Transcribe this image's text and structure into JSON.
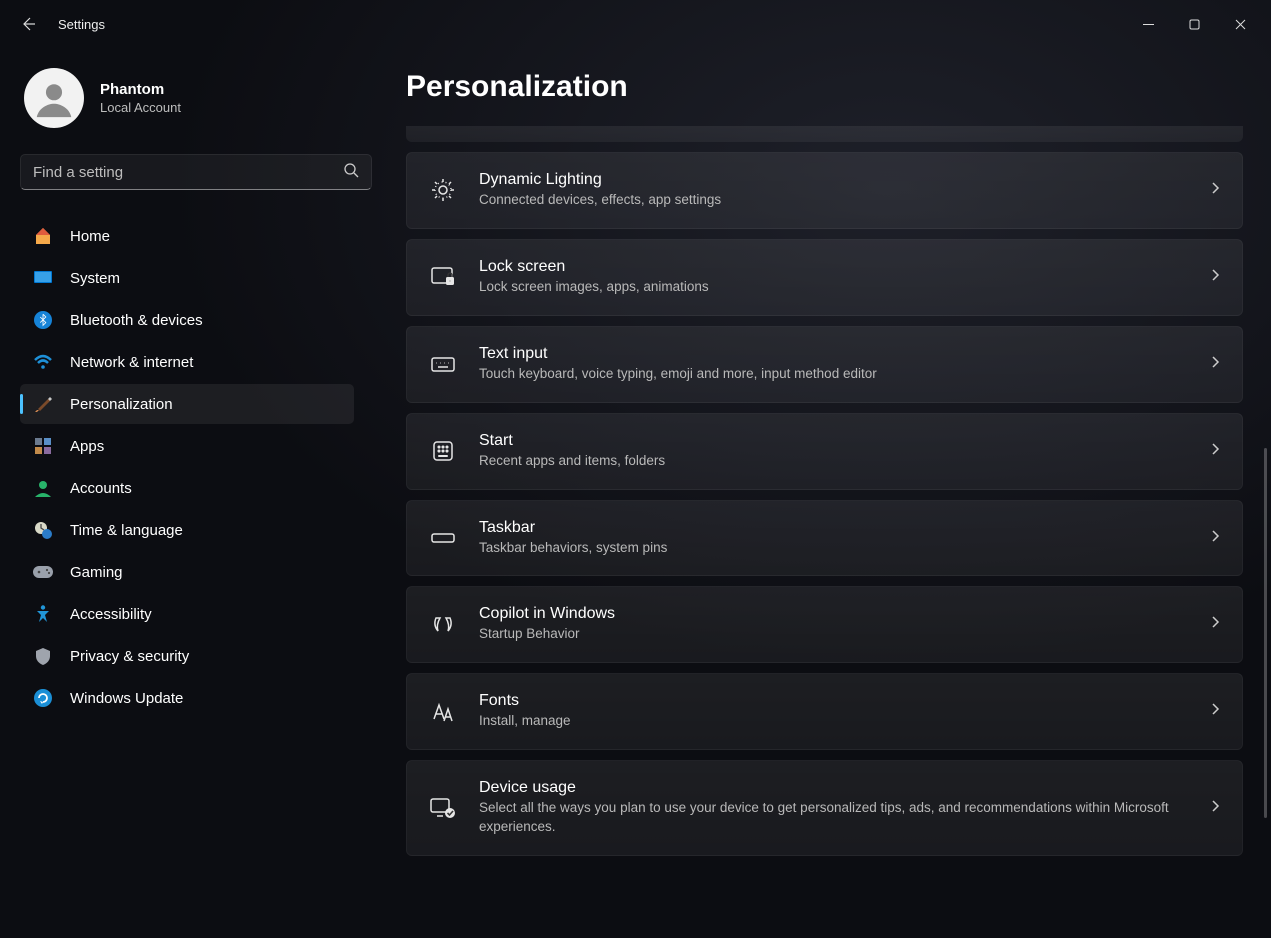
{
  "titlebar": {
    "title": "Settings"
  },
  "profile": {
    "name": "Phantom",
    "sub": "Local Account"
  },
  "search": {
    "placeholder": "Find a setting"
  },
  "page": {
    "title": "Personalization"
  },
  "sidebar": {
    "items": [
      {
        "label": "Home"
      },
      {
        "label": "System"
      },
      {
        "label": "Bluetooth & devices"
      },
      {
        "label": "Network & internet"
      },
      {
        "label": "Personalization"
      },
      {
        "label": "Apps"
      },
      {
        "label": "Accounts"
      },
      {
        "label": "Time & language"
      },
      {
        "label": "Gaming"
      },
      {
        "label": "Accessibility"
      },
      {
        "label": "Privacy & security"
      },
      {
        "label": "Windows Update"
      }
    ]
  },
  "cards": [
    {
      "title": "Dynamic Lighting",
      "desc": "Connected devices, effects, app settings"
    },
    {
      "title": "Lock screen",
      "desc": "Lock screen images, apps, animations"
    },
    {
      "title": "Text input",
      "desc": "Touch keyboard, voice typing, emoji and more, input method editor"
    },
    {
      "title": "Start",
      "desc": "Recent apps and items, folders"
    },
    {
      "title": "Taskbar",
      "desc": "Taskbar behaviors, system pins"
    },
    {
      "title": "Copilot in Windows",
      "desc": "Startup Behavior"
    },
    {
      "title": "Fonts",
      "desc": "Install, manage"
    },
    {
      "title": "Device usage",
      "desc": "Select all the ways you plan to use your device to get personalized tips, ads, and recommendations within Microsoft experiences."
    }
  ]
}
